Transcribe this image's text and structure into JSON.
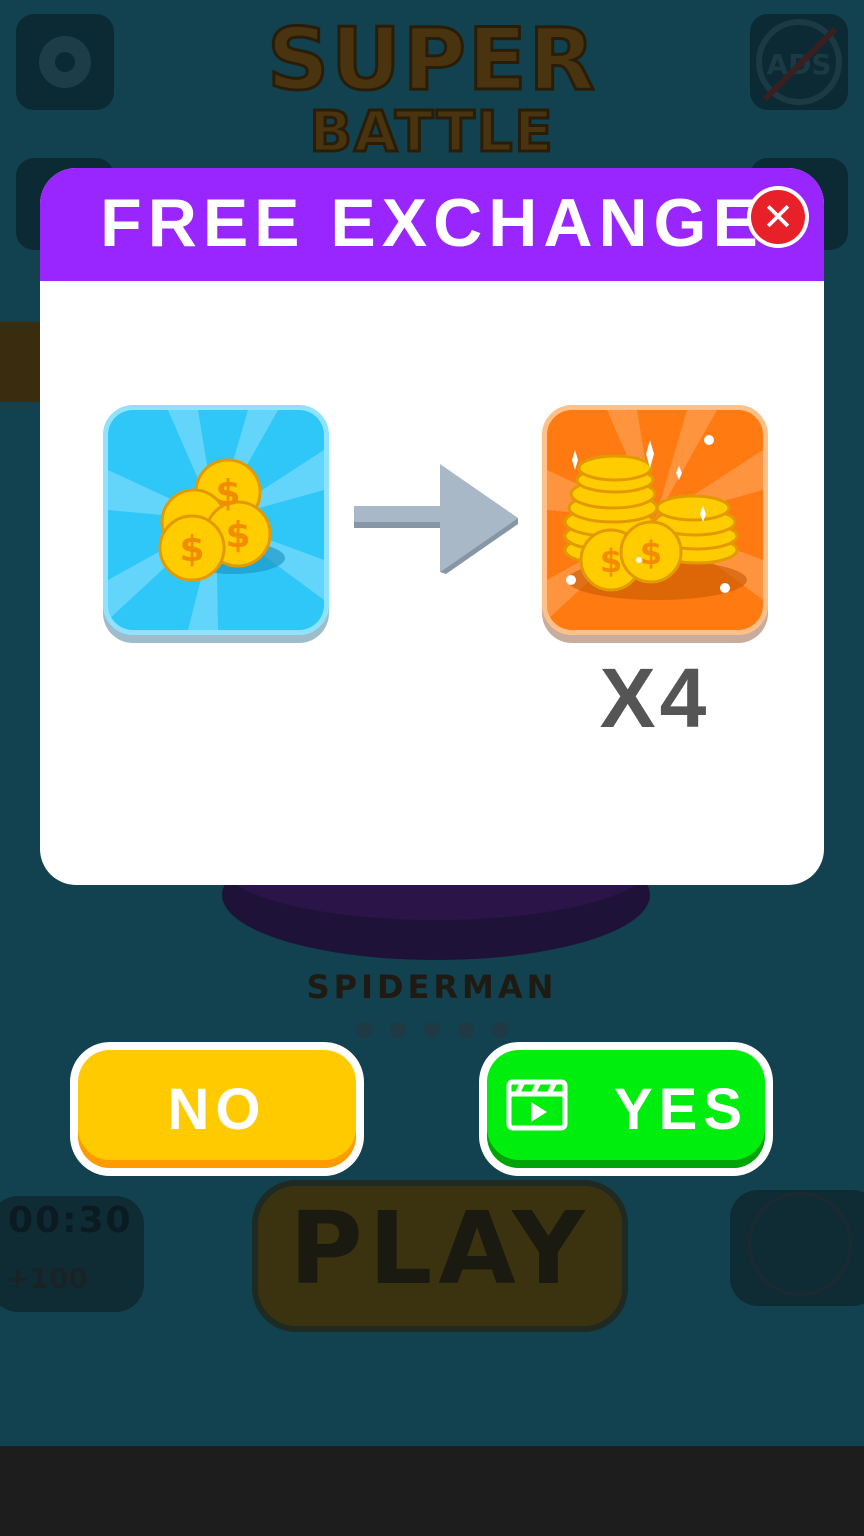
{
  "background": {
    "title_line1": "SUPER",
    "title_line2": "BATTLE",
    "character_name": "SPIDERMAN",
    "play_label": "PLAY",
    "timer": "00:30",
    "reward_text": "+100",
    "ads_label": "ADS"
  },
  "modal": {
    "title": "FREE EXCHANGE",
    "multiplier": "X4",
    "header_color": "#9a26ff"
  },
  "buttons": {
    "no_label": "NO",
    "yes_label": "YES"
  },
  "icons": {
    "close": "close-icon",
    "settings": "gear-icon",
    "video": "video-clapper-icon",
    "arrow": "arrow-right-icon"
  }
}
